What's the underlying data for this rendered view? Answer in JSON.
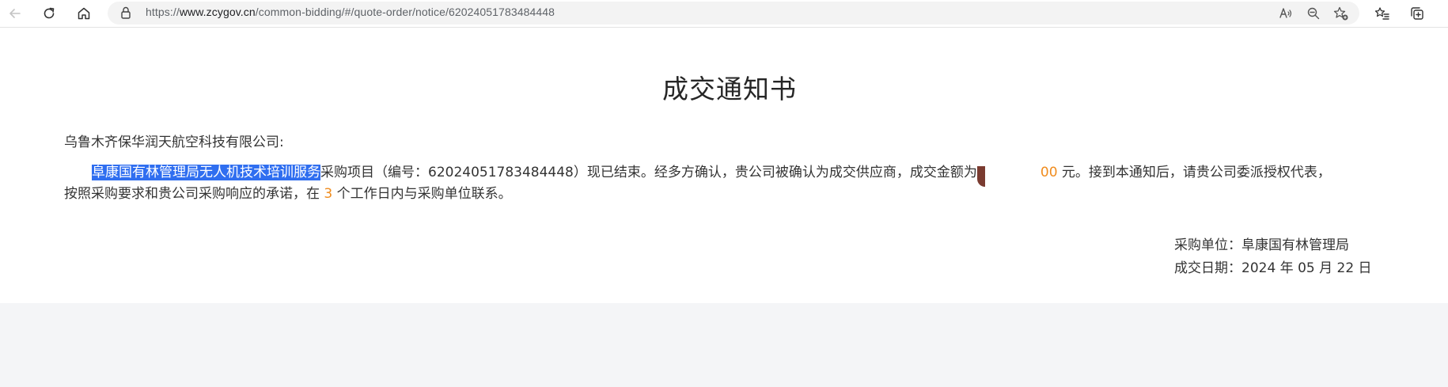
{
  "browser": {
    "url_scheme": "https://",
    "url_host": "www.zcygov.cn",
    "url_path": "/common-bidding/#/quote-order/notice/62024051783484448",
    "icons": [
      "back-icon",
      "refresh-icon",
      "home-icon",
      "lock-icon",
      "read-aloud-icon",
      "zoom-out-icon",
      "favorite-add-icon",
      "favorites-icon",
      "collections-icon"
    ]
  },
  "notice": {
    "title": "成交通知书",
    "recipient": "乌鲁木齐保华润天航空科技有限公司:",
    "project_name": "阜康国有林管理局无人机技术培训服务",
    "line1_after_project": "采购项目（编号：62024051783484448）现已结束。经多方确认，贵公司被确认为成交供应商，成交金额为",
    "amount_visible_tail": "00",
    "line1_after_amount": " 元。接到本通知后，请贵公司委派授权代表，",
    "line2_before_days": "按照采购要求和贵公司采购响应的承诺，在 ",
    "days": "3",
    "line2_after_days": " 个工作日内与采购单位联系。",
    "purchaser_label": "采购单位：",
    "purchaser": "阜康国有林管理局",
    "date_label": "成交日期：",
    "date": "2024 年 05 月 22 日"
  },
  "colors": {
    "highlight": "#2f6ef0",
    "accent_orange": "#f08c1e",
    "text": "#333333"
  }
}
